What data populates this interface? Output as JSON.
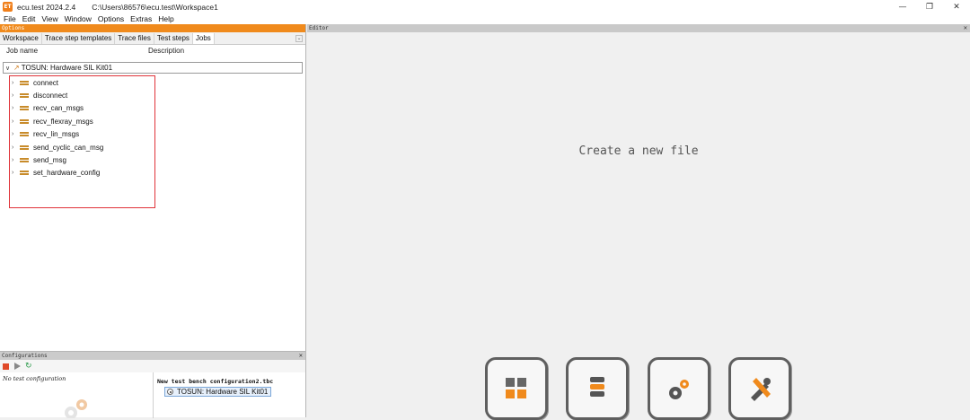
{
  "window": {
    "app_icon": "ET",
    "title": "ecu.test 2024.2.4",
    "path": "C:\\Users\\86576\\ecu.test\\Workspace1",
    "minimize": "—",
    "maximize": "❐",
    "close": "✕"
  },
  "menu": [
    "File",
    "Edit",
    "View",
    "Window",
    "Options",
    "Extras",
    "Help"
  ],
  "options_panel": {
    "header": "Options",
    "tabs": [
      "Workspace",
      "Trace step templates",
      "Trace files",
      "Test steps",
      "Jobs"
    ],
    "active_tab": "Jobs",
    "columns": [
      "Job name",
      "Description"
    ],
    "root_job": "TOSUN: Hardware SIL Kit01",
    "jobs": [
      "connect",
      "disconnect",
      "recv_can_msgs",
      "recv_flexray_msgs",
      "recv_lin_msgs",
      "send_cyclic_can_msg",
      "send_msg",
      "set_hardware_config"
    ]
  },
  "configurations_panel": {
    "header": "Configurations",
    "no_config": "No test configuration",
    "bench_title": "New test bench configuration2.tbc",
    "bench_item": "TOSUN: Hardware SIL Kit01"
  },
  "editor": {
    "header": "Editor",
    "placeholder": "Create a new file"
  },
  "colors": {
    "accent": "#f08a1c",
    "highlight_box": "#e0333a"
  },
  "icons": [
    "app-icon",
    "chevron-down-icon",
    "wrench-icon",
    "job-icon",
    "stop-icon",
    "play-icon",
    "refresh-icon",
    "gear-icon",
    "grid-icon",
    "database-icon",
    "settings-icon",
    "tools-icon"
  ]
}
